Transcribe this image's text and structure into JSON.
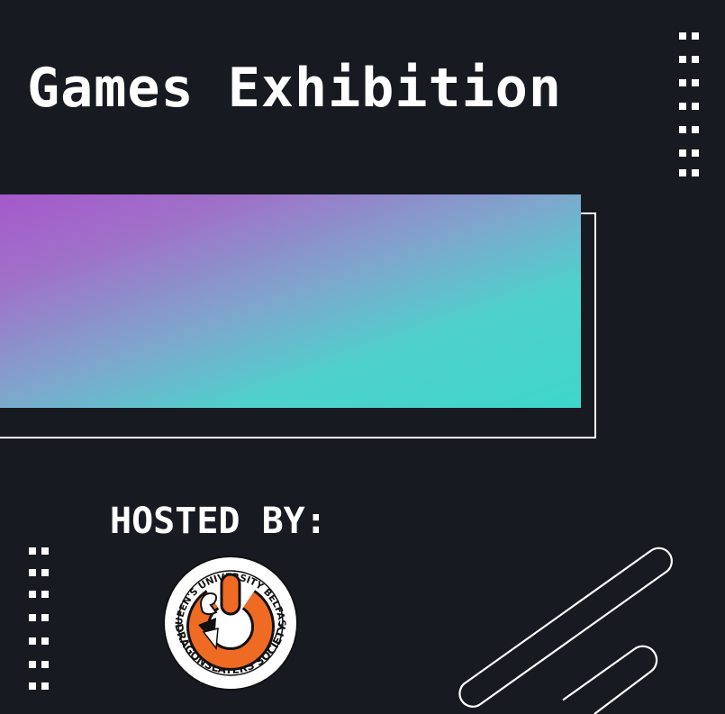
{
  "title": "Games Exhibition",
  "hosted_label": "HOSTED BY:",
  "logo": {
    "ring_text_top": "QUEEN'S UNIVERSITY BELFAST",
    "ring_text_bottom": "DRAGONSLAYERS SOCIETY",
    "icon": "dragon-power-icon"
  },
  "colors": {
    "background": "#181a21",
    "gradient_start": "#a658cb",
    "gradient_end": "#3ed6cb",
    "logo_orange": "#ef6a22",
    "text": "#ffffff"
  }
}
